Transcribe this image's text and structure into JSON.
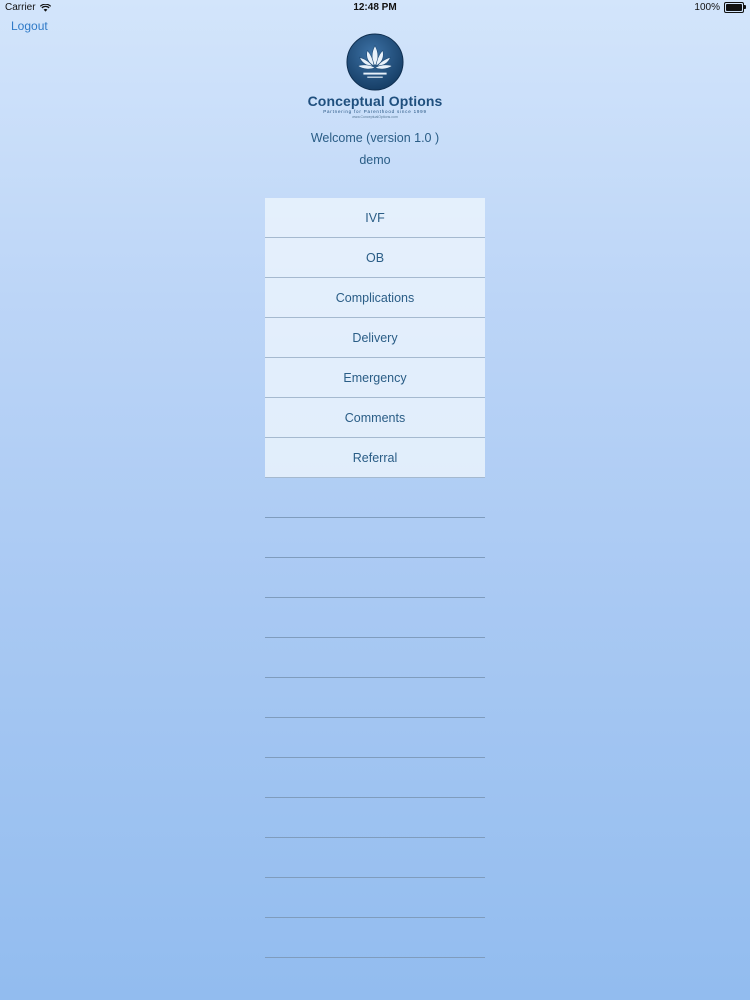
{
  "status_bar": {
    "carrier": "Carrier",
    "time": "12:48 PM",
    "battery": "100%"
  },
  "nav": {
    "logout_label": "Logout"
  },
  "logo": {
    "name": "Conceptual Options",
    "tagline": "Partnering for Parenthood since 1999",
    "url": "www.ConceptualOptions.com"
  },
  "welcome": {
    "text": "Welcome (version 1.0 )",
    "username": "demo"
  },
  "menu": {
    "items": [
      {
        "label": "IVF"
      },
      {
        "label": "OB"
      },
      {
        "label": "Complications"
      },
      {
        "label": "Delivery"
      },
      {
        "label": "Emergency"
      },
      {
        "label": "Comments"
      },
      {
        "label": "Referral"
      }
    ]
  },
  "colors": {
    "accent": "#2f7ac7",
    "text": "#2a5d86",
    "brand": "#1f4f7e"
  }
}
